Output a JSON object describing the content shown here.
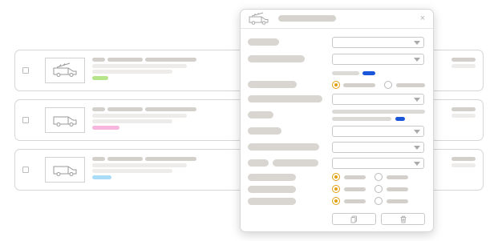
{
  "list": {
    "rows": [
      {
        "accent": "#b5e58a"
      },
      {
        "accent": "#f7b6de"
      },
      {
        "accent": "#a9dcf7"
      }
    ]
  },
  "dialog": {
    "close_glyph": "×",
    "accent_color": "#e3a013",
    "link_color": "#1a56d8",
    "footer_icons": [
      "copy-icon",
      "trash-icon"
    ]
  }
}
